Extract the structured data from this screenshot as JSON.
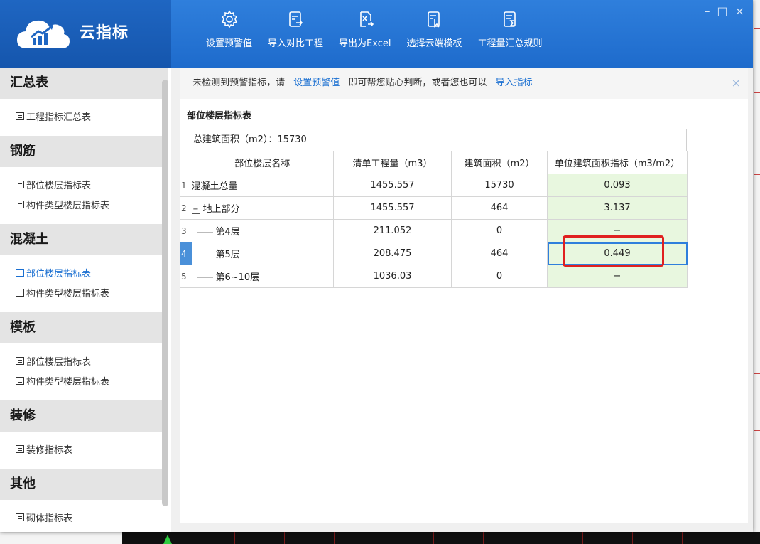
{
  "header": {
    "app_title": "云指标",
    "toolbar": [
      {
        "label": "设置预警值",
        "icon": "settings-gear-icon"
      },
      {
        "label": "导入对比工程",
        "icon": "import-document-icon"
      },
      {
        "label": "导出为Excel",
        "icon": "excel-export-icon"
      },
      {
        "label": "选择云端模板",
        "icon": "template-select-icon"
      },
      {
        "label": "工程量汇总规则",
        "icon": "sum-rule-icon"
      }
    ],
    "window_controls": {
      "minimize": "–",
      "maximize": "□",
      "close": "×"
    }
  },
  "sidebar": {
    "groups": [
      {
        "title": "汇总表",
        "items": [
          {
            "label": "工程指标汇总表"
          }
        ]
      },
      {
        "title": "钢筋",
        "items": [
          {
            "label": "部位楼层指标表"
          },
          {
            "label": "构件类型楼层指标表"
          }
        ]
      },
      {
        "title": "混凝土",
        "items": [
          {
            "label": "部位楼层指标表",
            "active": true
          },
          {
            "label": "构件类型楼层指标表"
          }
        ]
      },
      {
        "title": "模板",
        "items": [
          {
            "label": "部位楼层指标表"
          },
          {
            "label": "构件类型楼层指标表"
          }
        ]
      },
      {
        "title": "装修",
        "items": [
          {
            "label": "装修指标表"
          }
        ]
      },
      {
        "title": "其他",
        "items": [
          {
            "label": "砌体指标表"
          }
        ]
      }
    ]
  },
  "notice": {
    "part1": "未检测到预警指标，请",
    "link1": "设置预警值",
    "part2": "即可帮您贴心判断，或者您也可以",
    "link2": "导入指标",
    "close": "×"
  },
  "main": {
    "section_title": "部位楼层指标表",
    "summary": "总建筑面积（m2）：15730",
    "columns": [
      "部位楼层名称",
      "清单工程量（m3）",
      "建筑面积（m2）",
      "单位建筑面积指标（m3/m2）"
    ],
    "rows": [
      {
        "idx": "1",
        "name": "混凝土总量",
        "qty": "1455.557",
        "area": "15730",
        "metric": "0.093",
        "level": 0
      },
      {
        "idx": "2",
        "name": "地上部分",
        "qty": "1455.557",
        "area": "464",
        "metric": "3.137",
        "level": 0,
        "toggle": "−"
      },
      {
        "idx": "3",
        "name": "第4层",
        "qty": "211.052",
        "area": "0",
        "metric": "−",
        "level": 1
      },
      {
        "idx": "4",
        "name": "第5层",
        "qty": "208.475",
        "area": "464",
        "metric": "0.449",
        "level": 1,
        "selected": true
      },
      {
        "idx": "5",
        "name": "第6~10层",
        "qty": "1036.03",
        "area": "0",
        "metric": "−",
        "level": 1
      }
    ]
  }
}
